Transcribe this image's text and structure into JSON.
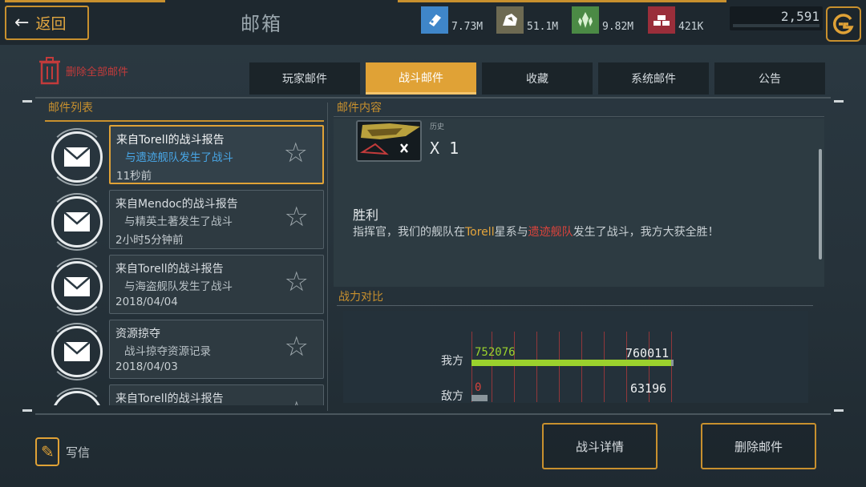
{
  "header": {
    "back_label": "返回",
    "title": "邮箱",
    "resources": [
      {
        "icon": "ship-module-icon",
        "value": "7.73M",
        "color": "#3f86c9"
      },
      {
        "icon": "ore-rock-icon",
        "value": "51.1M",
        "color": "#6d6a52"
      },
      {
        "icon": "crystal-icon",
        "value": "9.82M",
        "color": "#4b8a45"
      },
      {
        "icon": "alloy-bars-icon",
        "value": "421K",
        "color": "#9a2e3a"
      }
    ],
    "credits": "2,591"
  },
  "toolbar": {
    "delete_all_label": "删除全部邮件"
  },
  "tabs": [
    {
      "label": "玩家邮件",
      "active": false
    },
    {
      "label": "战斗邮件",
      "active": true
    },
    {
      "label": "收藏",
      "active": false
    },
    {
      "label": "系统邮件",
      "active": false
    },
    {
      "label": "公告",
      "active": false
    }
  ],
  "mail_list": {
    "title": "邮件列表",
    "items": [
      {
        "from": "来自Torell的战斗报告",
        "subject": "与遗迹舰队发生了战斗",
        "time": "11秒前",
        "selected": true
      },
      {
        "from": "来自Mendoc的战斗报告",
        "subject": "与精英土著发生了战斗",
        "time": "2小时5分钟前",
        "selected": false
      },
      {
        "from": "来自Torell的战斗报告",
        "subject": "与海盗舰队发生了战斗",
        "time": "2018/04/04",
        "selected": false
      },
      {
        "from": "资源掠夺",
        "subject": "战斗掠夺资源记录",
        "time": "2018/04/03",
        "selected": false
      },
      {
        "from": "来自Torell的战斗报告",
        "subject": "",
        "time": "",
        "selected": false
      }
    ]
  },
  "mail_content": {
    "title": "邮件内容",
    "item_small_text": "历史",
    "item_count": "X 1",
    "victory_title": "胜利",
    "message": {
      "prefix": "指挥官，我们的舰队在",
      "system": "Torell",
      "mid": "星系与",
      "enemy": "遗迹舰队",
      "suffix": "发生了战斗，我方大获全胜！"
    }
  },
  "power_compare": {
    "title": "战力对比",
    "ours_label": "我方",
    "enemy_label": "敌方",
    "ours_left": "752076",
    "ours_right": "760011",
    "enemy_left": "0",
    "enemy_right": "63196",
    "ours_fraction": 0.99,
    "enemy_fraction": 0.08
  },
  "bottom": {
    "write_label": "写信",
    "battle_detail_label": "战斗详情",
    "delete_mail_label": "删除邮件"
  }
}
